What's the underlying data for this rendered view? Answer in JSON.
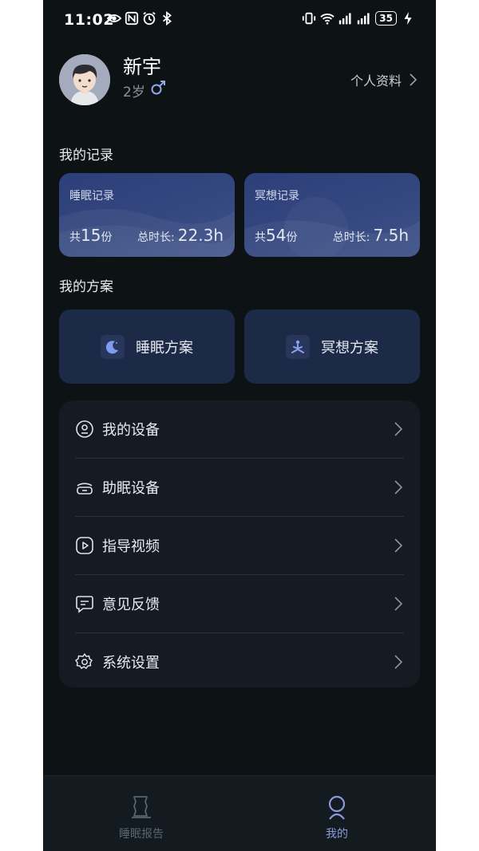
{
  "status_bar": {
    "time": "11:02",
    "battery": "35",
    "network_1": "4G",
    "network_2": "4G"
  },
  "profile": {
    "name": "新宇",
    "age": "2岁",
    "profile_link": "个人资料"
  },
  "records": {
    "section_title": "我的记录",
    "sleep": {
      "title": "睡眠记录",
      "count_prefix": "共",
      "count": "15",
      "count_suffix": "份",
      "total_label": "总时长:",
      "total": "22.3h"
    },
    "meditation": {
      "title": "冥想记录",
      "count_prefix": "共",
      "count": "54",
      "count_suffix": "份",
      "total_label": "总时长:",
      "total": "7.5h"
    }
  },
  "plans": {
    "section_title": "我的方案",
    "sleep_plan": "睡眠方案",
    "meditation_plan": "冥想方案"
  },
  "menu": [
    {
      "label": "我的设备",
      "icon": "device-icon"
    },
    {
      "label": "助眠设备",
      "icon": "sleep-aid-device-icon"
    },
    {
      "label": "指导视频",
      "icon": "video-play-icon"
    },
    {
      "label": "意见反馈",
      "icon": "feedback-icon"
    },
    {
      "label": "系统设置",
      "icon": "gear-icon"
    }
  ],
  "tabbar": {
    "sleep_report": "睡眠报告",
    "mine": "我的"
  },
  "colors": {
    "background": "#0d1215",
    "card_gradient": "#34477f",
    "plan_card": "#1c2a47",
    "menu_card": "#151b22",
    "tab_active": "#8a9bd6",
    "tab_inactive": "#5b6470"
  }
}
